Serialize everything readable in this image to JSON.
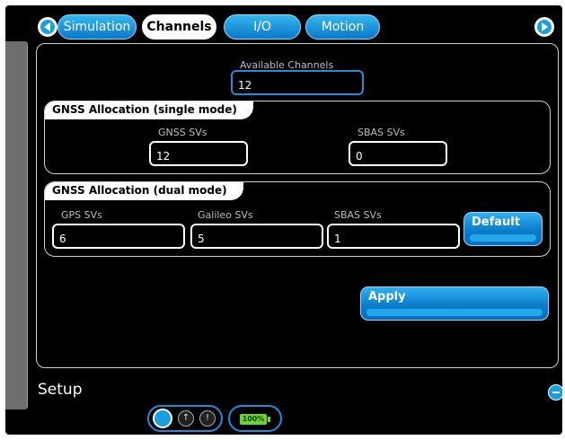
{
  "tabs": [
    {
      "label": "Simulation",
      "active": false
    },
    {
      "label": "Channels",
      "active": true
    },
    {
      "label": "I/O",
      "active": false
    },
    {
      "label": "Motion",
      "active": false
    }
  ],
  "available_channels": {
    "label": "Available Channels",
    "value": "12"
  },
  "single_mode": {
    "title": "GNSS Allocation (single mode)",
    "gnss": {
      "label": "GNSS SVs",
      "value": "12"
    },
    "sbas": {
      "label": "SBAS SVs",
      "value": "0"
    }
  },
  "dual_mode": {
    "title": "GNSS Allocation (dual mode)",
    "gps": {
      "label": "GPS SVs",
      "value": "6"
    },
    "galileo": {
      "label": "Galileo SVs",
      "value": "5"
    },
    "sbas": {
      "label": "SBAS SVs",
      "value": "1"
    },
    "default_label": "Default"
  },
  "apply_label": "Apply",
  "footer": {
    "section_label": "Setup",
    "battery_text": "100%"
  },
  "colors": {
    "accent": "#1a9fe0",
    "background": "#000000",
    "battery": "#6ad62a"
  },
  "icons": [
    "nav-left-icon",
    "nav-right-icon",
    "collapse-icon",
    "status-indicator-icon",
    "info-icon",
    "warning-icon",
    "battery-icon"
  ]
}
